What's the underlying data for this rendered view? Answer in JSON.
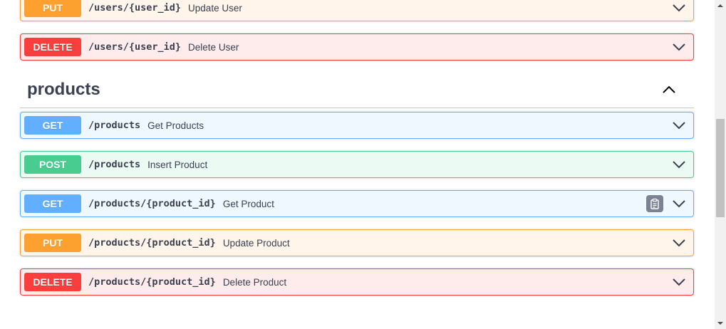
{
  "operations_top": [
    {
      "method": "PUT",
      "path": "/users/{user_id}",
      "summary": "Update User"
    },
    {
      "method": "DELETE",
      "path": "/users/{user_id}",
      "summary": "Delete User"
    }
  ],
  "products": {
    "title": "products",
    "toggle_icon": "chevron-up-icon",
    "operations": [
      {
        "method": "GET",
        "path": "/products",
        "summary": "Get Products"
      },
      {
        "method": "POST",
        "path": "/products",
        "summary": "Insert Product"
      },
      {
        "method": "GET",
        "path": "/products/{product_id}",
        "summary": "Get Product",
        "copy_icon": "clipboard-icon"
      },
      {
        "method": "PUT",
        "path": "/products/{product_id}",
        "summary": "Update Product"
      },
      {
        "method": "DELETE",
        "path": "/products/{product_id}",
        "summary": "Delete Product"
      }
    ]
  },
  "colors": {
    "get": "#61affe",
    "post": "#49cc90",
    "put": "#fca130",
    "delete": "#f93e3e",
    "text": "#3b4151"
  }
}
